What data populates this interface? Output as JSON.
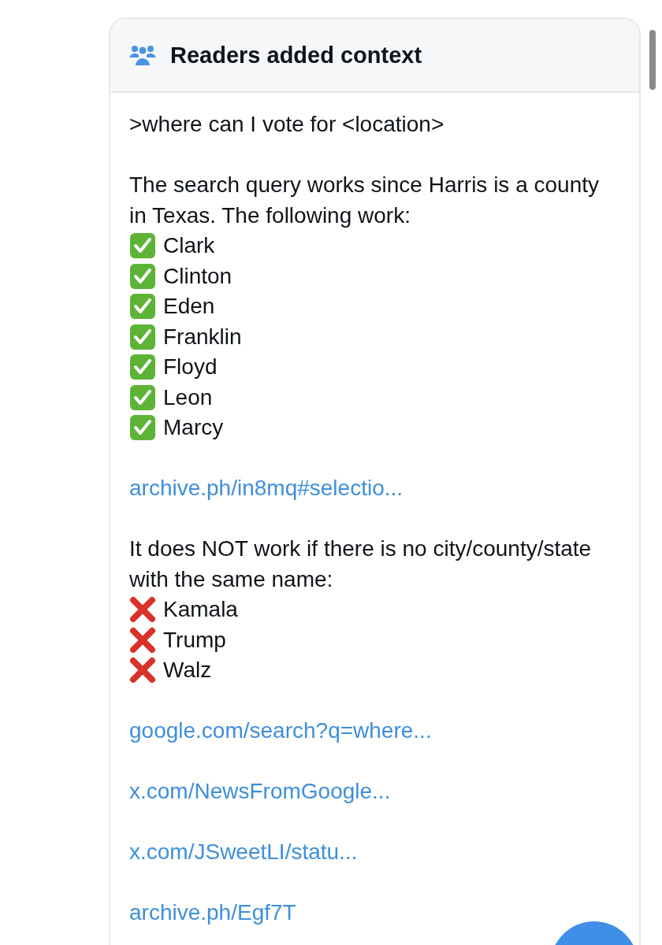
{
  "note": {
    "heading": "Readers added context",
    "blocks": [
      {
        "kind": "text",
        "text": ">where can I vote for <location>"
      },
      {
        "kind": "text",
        "text": "The search query works since Harris is a county in Texas. The following work:",
        "items": [
          {
            "kind": "check",
            "label": "Clark"
          },
          {
            "kind": "check",
            "label": "Clinton"
          },
          {
            "kind": "check",
            "label": "Eden"
          },
          {
            "kind": "check",
            "label": "Franklin"
          },
          {
            "kind": "check",
            "label": "Floyd"
          },
          {
            "kind": "check",
            "label": "Leon"
          },
          {
            "kind": "check",
            "label": "Marcy"
          }
        ]
      },
      {
        "kind": "link",
        "text": "archive.ph/in8mq#selectio..."
      },
      {
        "kind": "text",
        "text": "It does NOT work if there is no city/county/state with the same name:",
        "items": [
          {
            "kind": "cross",
            "label": "Kamala"
          },
          {
            "kind": "cross",
            "label": "Trump"
          },
          {
            "kind": "cross",
            "label": "Walz"
          }
        ]
      },
      {
        "kind": "link",
        "text": "google.com/search?q=where..."
      },
      {
        "kind": "link",
        "text": "x.com/NewsFromGoogle..."
      },
      {
        "kind": "link",
        "text": "x.com/JSweetLI/statu..."
      },
      {
        "kind": "link",
        "text": "archive.ph/Egf7T"
      }
    ]
  }
}
